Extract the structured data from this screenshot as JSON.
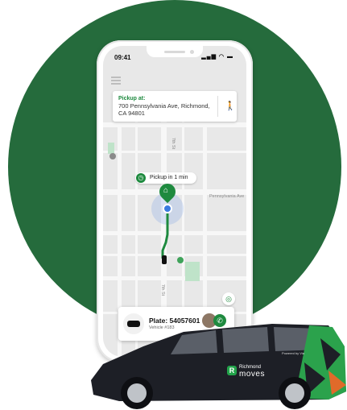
{
  "status_bar": {
    "time": "09:41",
    "indicators": "signal wifi battery"
  },
  "pickup": {
    "label": "Pickup at:",
    "address": "700 Pennsylvania Ave, Richmond, CA 94801"
  },
  "map": {
    "streets": [
      "7th St",
      "Pennsylvania Ave",
      "7th St"
    ]
  },
  "eta": {
    "text": "Pickup in 1 min"
  },
  "vehicle": {
    "plate": "Plate: 54057601",
    "vehicle_id": "Vehicle #183"
  },
  "branding": {
    "line1": "Richmond",
    "line2": "moves",
    "powered": "Powered by Via"
  },
  "colors": {
    "brand_green": "#256b3c",
    "accent_green": "#1e8a3f",
    "location_blue": "#3a7be0"
  },
  "icons": [
    "menu-icon",
    "walk-icon",
    "clock-icon",
    "home-pin-icon",
    "locate-icon",
    "phone-icon"
  ]
}
